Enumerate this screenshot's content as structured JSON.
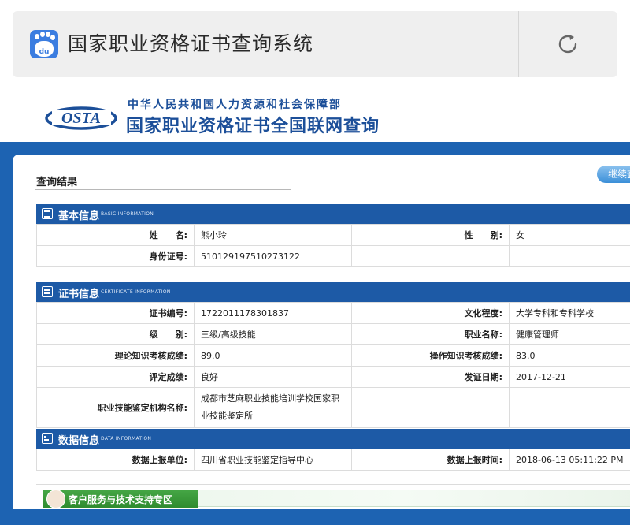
{
  "browser": {
    "title": "国家职业资格证书查询系统",
    "logo_text": "du",
    "logo_icon": "baidu-paw-icon",
    "reload_icon": "reload-icon"
  },
  "header": {
    "logo_text": "OSTA",
    "ministry": "中华人民共和国人力资源和社会保障部",
    "portal": "国家职业资格证书全国联网查询"
  },
  "result": {
    "title": "查询结果",
    "continue_label": "继续查询"
  },
  "basic": {
    "title": "基本信息",
    "subtitle": "BASIC INFORMATION",
    "name_label": "姓　　名:",
    "name_value": "熊小玲",
    "gender_label": "性　　别:",
    "gender_value": "女",
    "id_label": "身份证号:",
    "id_value": "510129197510273122"
  },
  "certificate": {
    "title": "证书信息",
    "subtitle": "CERTIFICATE INFORMATION",
    "number_label": "证书编号:",
    "number_value": "1722011178301837",
    "education_label": "文化程度:",
    "education_value": "大学专科和专科学校",
    "level_label": "级　　别:",
    "level_value": "三级/高级技能",
    "occupation_label": "职业名称:",
    "occupation_value": "健康管理师",
    "theory_label": "理论知识考核成绩:",
    "theory_value": "89.0",
    "practice_label": "操作知识考核成绩:",
    "practice_value": "83.0",
    "rating_label": "评定成绩:",
    "rating_value": "良好",
    "issue_date_label": "发证日期:",
    "issue_date_value": "2017-12-21",
    "agency_label": "职业技能鉴定机构名称:",
    "agency_value_line1": "成都市芝麻职业技能培训学校国家职",
    "agency_value_line2": "业技能鉴定所"
  },
  "data_info": {
    "title": "数据信息",
    "subtitle": "DATA INFORMATION",
    "unit_label": "数据上报单位:",
    "unit_value": "四川省职业技能鉴定指导中心",
    "time_label": "数据上报时间:",
    "time_value": "2018-06-13 05:11:22 PM"
  },
  "support": {
    "label": "客户服务与技术支持专区"
  },
  "colors": {
    "brand_blue": "#1d63b2",
    "section_blue": "#1d5aa6",
    "support_green": "#2e8a2e"
  }
}
